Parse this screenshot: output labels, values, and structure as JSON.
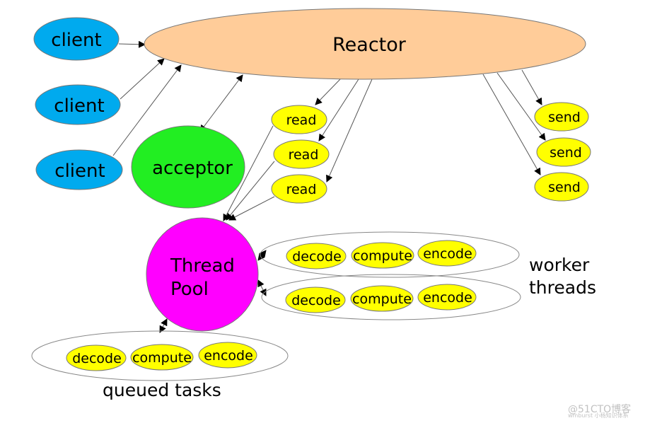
{
  "colors": {
    "reactor": "#ffcc99",
    "client": "#00aaee",
    "acceptor": "#22ee22",
    "task": "#ffff00",
    "thread_pool": "#ff00ff",
    "outline": "#777777"
  },
  "reactor": {
    "label": "Reactor"
  },
  "clients": [
    {
      "label": "client"
    },
    {
      "label": "client"
    },
    {
      "label": "client"
    }
  ],
  "acceptor": {
    "label": "acceptor"
  },
  "reads": [
    {
      "label": "read"
    },
    {
      "label": "read"
    },
    {
      "label": "read"
    }
  ],
  "sends": [
    {
      "label": "send"
    },
    {
      "label": "send"
    },
    {
      "label": "send"
    }
  ],
  "thread_pool": {
    "line1": "Thread",
    "line2": "Pool"
  },
  "worker_rows": [
    {
      "tasks": [
        "decode",
        "compute",
        "encode"
      ]
    },
    {
      "tasks": [
        "decode",
        "compute",
        "encode"
      ]
    }
  ],
  "worker_label": {
    "line1": "worker",
    "line2": "threads"
  },
  "queued": {
    "tasks": [
      "decode",
      "compute",
      "encode"
    ],
    "label": "queued tasks"
  },
  "watermark": {
    "line1": "@51CTO博客",
    "line2": "wmburst 小杨知识体系"
  }
}
